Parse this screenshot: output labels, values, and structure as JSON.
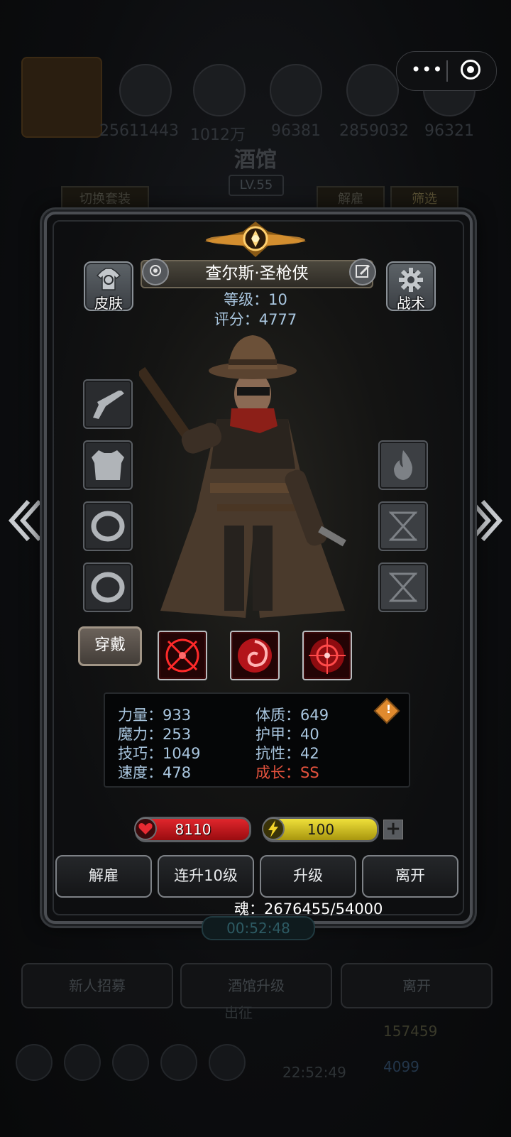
{
  "background": {
    "resource_values": [
      "25611443",
      "1012万",
      "96381",
      "2859032",
      "96321"
    ],
    "title": "酒馆",
    "level": "LV.55",
    "switch_outfit": "切换套装",
    "dismiss_tab": "解雇",
    "filter_tab": "筛选",
    "buttons": [
      "新人招募",
      "酒馆升级",
      "离开"
    ],
    "expedition": "出征",
    "timer": "00:52:48",
    "clock": "22:52:49",
    "gold": "157459",
    "gems": "4099"
  },
  "capsule": {
    "more_icon": "more-dots-icon",
    "close_icon": "target-circle-icon"
  },
  "hero": {
    "skin_label": "皮肤",
    "tactics_label": "战术",
    "name": "查尔斯·圣枪侠",
    "level_text": "等级：10",
    "score_text": "评分：4777",
    "wear_label": "穿戴",
    "left_equipment": [
      "pistol-icon",
      "armor-silhouette-icon",
      "ring-icon",
      "ring-icon"
    ],
    "right_slots": [
      "flame-icon",
      "hourglass-icon",
      "hourglass-icon"
    ],
    "skills": [
      "crosshair-burst-icon",
      "red-swirl-icon",
      "red-target-icon"
    ],
    "stats": {
      "strength": "力量：933",
      "magic": "魔力：253",
      "skill": "技巧：1049",
      "speed": "速度：478",
      "constitution": "体质：649",
      "armor": "护甲：40",
      "resistance": "抗性：42",
      "growth": "成长：SS"
    },
    "hp": {
      "value": "8110",
      "fill": 1.0,
      "color": "#c8121a"
    },
    "energy": {
      "value": "100",
      "fill": 1.0,
      "color": "#d7c61a"
    },
    "actions": [
      "解雇",
      "连升10级",
      "升级",
      "离开"
    ],
    "soul_text": "魂：2676455/54000"
  },
  "colors": {
    "stat_text": "#a9c6df",
    "growth_text": "#e4523d"
  }
}
